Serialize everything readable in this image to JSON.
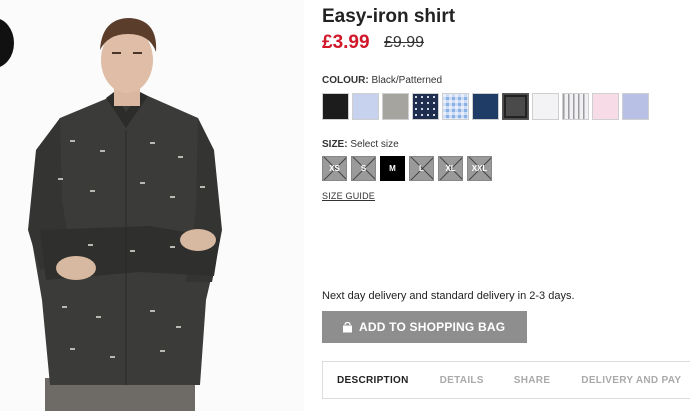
{
  "product": {
    "title": "Easy-iron shirt",
    "price_now": "£3.99",
    "price_was": "£9.99"
  },
  "colour": {
    "label": "COLOUR:",
    "selected_name": "Black/Patterned",
    "swatches": [
      {
        "name": "black",
        "color": "#1c1c1c"
      },
      {
        "name": "light-blue",
        "color": "#c6d2ee"
      },
      {
        "name": "grey",
        "color": "#a6a49f"
      },
      {
        "name": "navy-dotted",
        "color": "#1f2d4e"
      },
      {
        "name": "blue-check",
        "color": "#8cb1e6"
      },
      {
        "name": "dark-blue",
        "color": "#1f3c66"
      },
      {
        "name": "black-patterned",
        "color": "#4a4a4a",
        "selected": true
      },
      {
        "name": "white",
        "color": "#f3f3f6"
      },
      {
        "name": "grey-stripe",
        "color": "#d8d8dc"
      },
      {
        "name": "pink",
        "color": "#f7dbe6"
      },
      {
        "name": "lavender",
        "color": "#b8c0e6"
      }
    ]
  },
  "size": {
    "label": "SIZE:",
    "placeholder": "Select size",
    "options": [
      {
        "label": "XS",
        "available": false
      },
      {
        "label": "S",
        "available": false
      },
      {
        "label": "M",
        "available": true,
        "selected": true
      },
      {
        "label": "L",
        "available": false
      },
      {
        "label": "XL",
        "available": false
      },
      {
        "label": "XXL",
        "available": false
      }
    ],
    "guide_link": "SIZE GUIDE"
  },
  "delivery_text": "Next day delivery and standard delivery in 2-3 days.",
  "add_to_bag_label": "ADD TO SHOPPING BAG",
  "tabs": [
    "DESCRIPTION",
    "DETAILS",
    "SHARE",
    "DELIVERY AND PAY"
  ],
  "colors": {
    "price": "#d1182b",
    "button": "#8e8e8e"
  }
}
